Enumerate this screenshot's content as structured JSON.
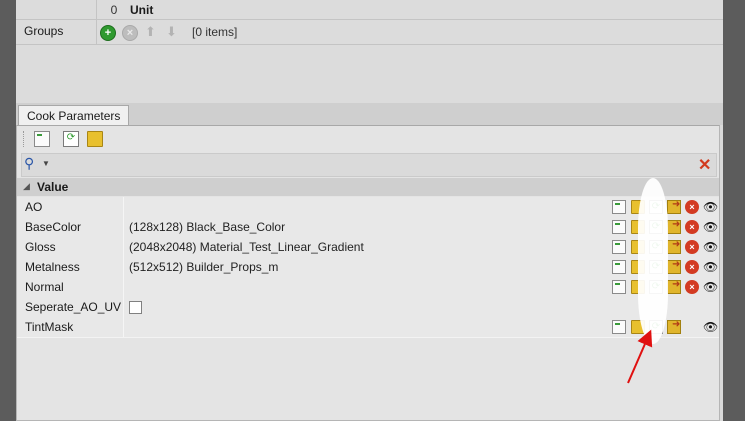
{
  "top_panel": {
    "unit_row": {
      "value": "0",
      "label": "Unit"
    },
    "groups_row": {
      "label": "Groups",
      "items": "[0 items]"
    }
  },
  "tabs": [
    {
      "label": "Cook Parameters"
    }
  ],
  "value_group": {
    "label": "Value"
  },
  "parameters": [
    {
      "name": "AO",
      "value": ""
    },
    {
      "name": "BaseColor",
      "value": "(128x128)   Black_Base_Color"
    },
    {
      "name": "Gloss",
      "value": "(2048x2048)   Material_Test_Linear_Gradient"
    },
    {
      "name": "Metalness",
      "value": "(512x512)   Builder_Props_m"
    },
    {
      "name": "Normal",
      "value": ""
    },
    {
      "name": "Seperate_AO_UV",
      "value": ""
    },
    {
      "name": "TintMask",
      "value": ""
    }
  ],
  "icons": {
    "add_group": "plus-circle-icon",
    "remove_group": "x-circle-icon",
    "move_up": "arrow-up-icon",
    "move_down": "arrow-down-icon",
    "search": "magnifier-icon",
    "clear_search": "red-x-icon",
    "row_actions": [
      "new-texture-icon",
      "open-folder-icon",
      "reload-icon",
      "export-icon",
      "clear-icon",
      "view-icon"
    ]
  },
  "colors": {
    "annotation": "#e01010",
    "highlight": "#ffffff"
  }
}
